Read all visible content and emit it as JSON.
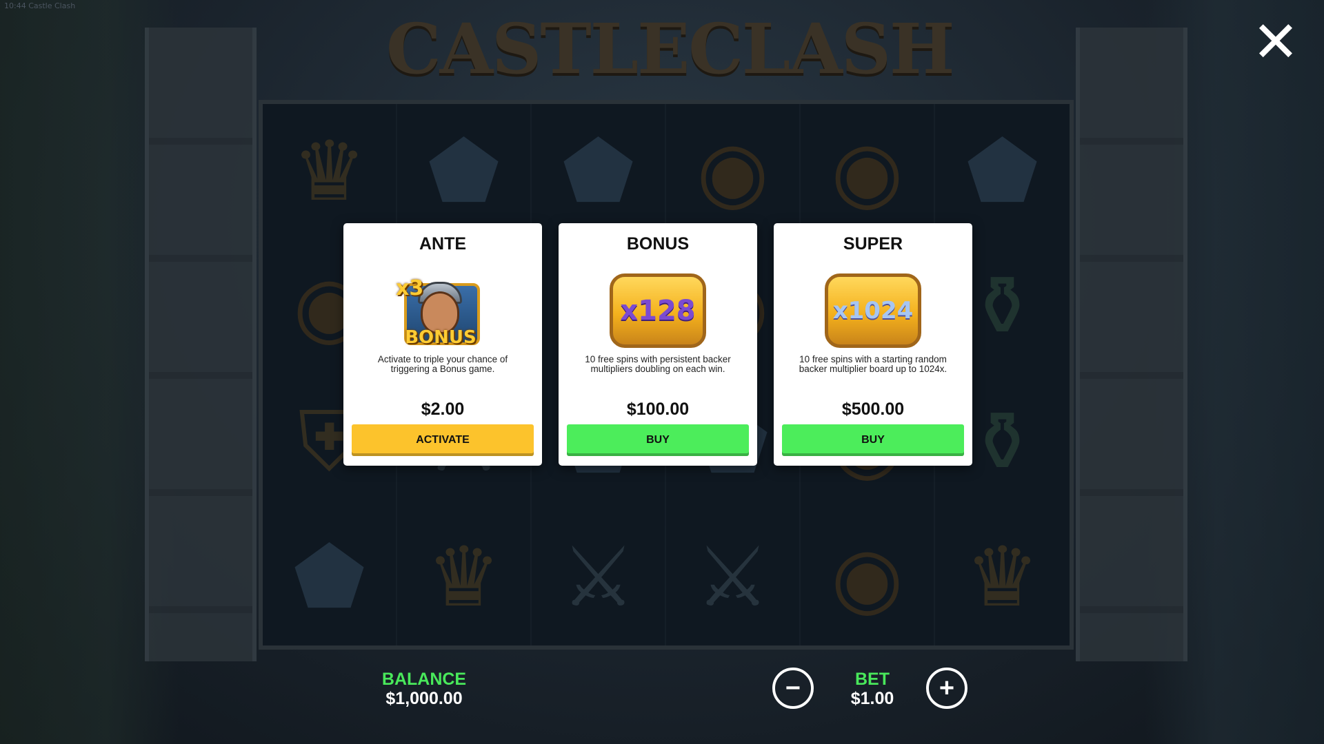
{
  "window_title": "10:44 Castle Clash",
  "game_title": "CASTLECLASH",
  "close_icon": "close-icon",
  "reel_symbols": [
    [
      "crown",
      "gem",
      "gem",
      "coin",
      "coin",
      "gem"
    ],
    [
      "coin",
      "sword",
      "gem",
      "coin",
      "coin",
      "potion"
    ],
    [
      "shield",
      "sword",
      "gem",
      "gem",
      "coin",
      "potion"
    ],
    [
      "gem",
      "crown",
      "sword",
      "sword",
      "coin",
      "crown"
    ]
  ],
  "cards": [
    {
      "title": "ANTE",
      "art": {
        "multiplier": "x3",
        "bonus": "BONUS"
      },
      "description": "Activate to triple your chance of triggering a Bonus game.",
      "price": "$2.00",
      "button": "ACTIVATE",
      "button_color": "#fcc32c"
    },
    {
      "title": "BONUS",
      "art": {
        "plaque": "x128"
      },
      "description": "10 free spins with persistent backer multipliers doubling on each win.",
      "price": "$100.00",
      "button": "BUY",
      "button_color": "#4ced5b"
    },
    {
      "title": "SUPER",
      "art": {
        "plaque": "x1024"
      },
      "description": "10 free spins with a starting random backer multiplier board up to 1024x.",
      "price": "$500.00",
      "button": "BUY",
      "button_color": "#4ced5b"
    }
  ],
  "footer": {
    "balance_label": "BALANCE",
    "balance_value": "$1,000.00",
    "bet_label": "BET",
    "bet_value": "$1.00",
    "minus_icon": "minus-icon",
    "plus_icon": "plus-icon"
  },
  "colors": {
    "label_green": "#49e85b",
    "button_yellow": "#fcc32c",
    "button_green": "#4ced5b"
  }
}
